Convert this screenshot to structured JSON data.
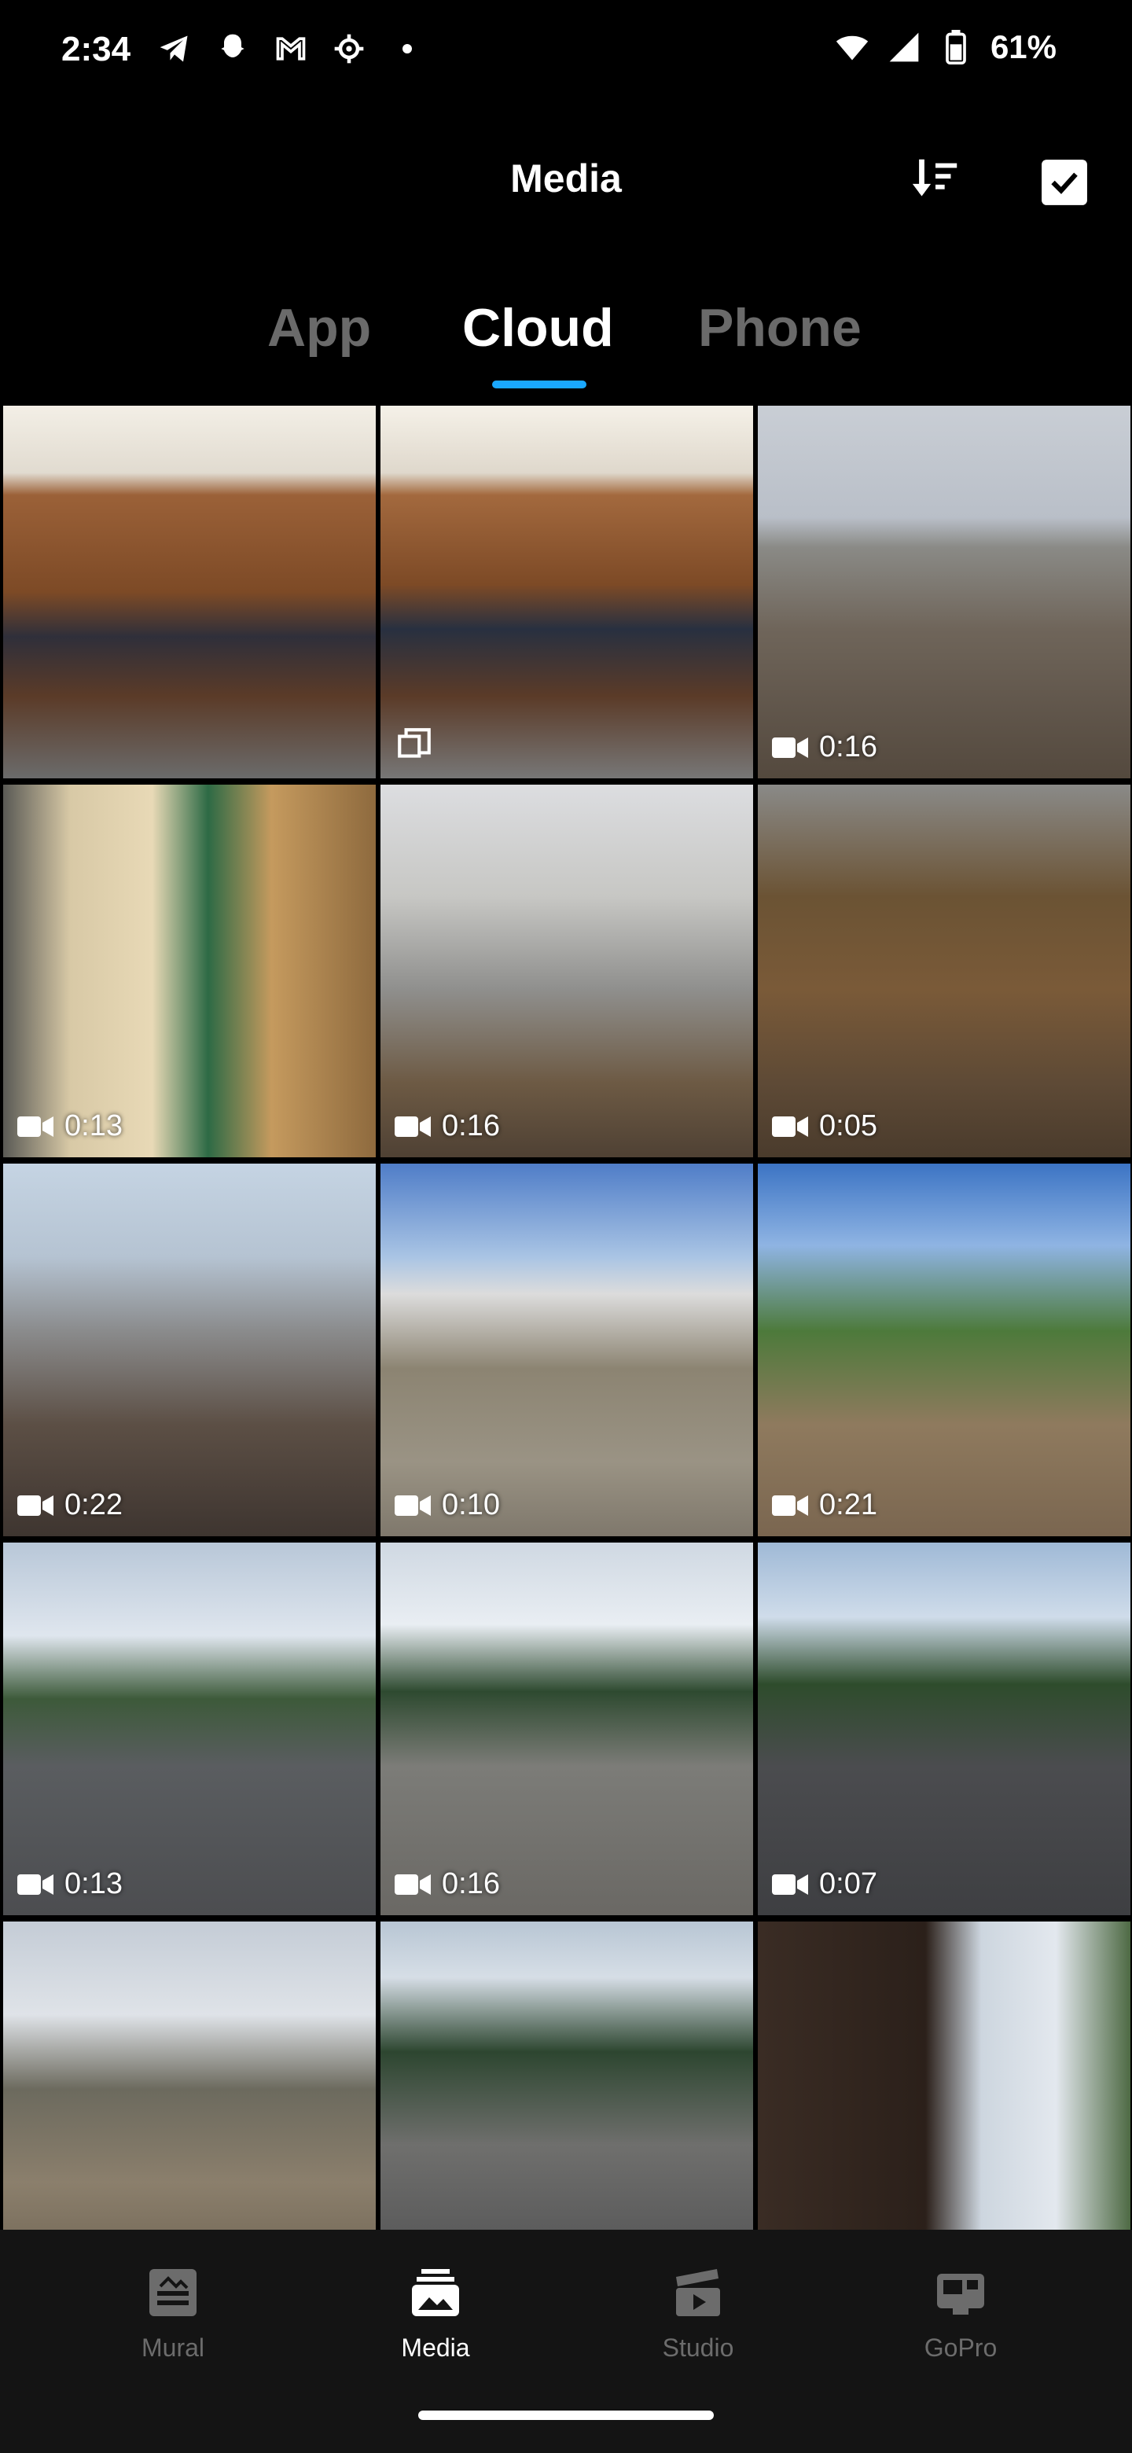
{
  "status_bar": {
    "time": "2:34",
    "battery_text": "61%"
  },
  "header": {
    "title": "Media"
  },
  "tabs": [
    {
      "label": "App",
      "active": false
    },
    {
      "label": "Cloud",
      "active": true
    },
    {
      "label": "Phone",
      "active": false
    }
  ],
  "grid": {
    "items": [
      {
        "type": "multi",
        "duration": ""
      },
      {
        "type": "multi",
        "duration": ""
      },
      {
        "type": "video",
        "duration": "0:16"
      },
      {
        "type": "video",
        "duration": "0:13"
      },
      {
        "type": "video",
        "duration": "0:16"
      },
      {
        "type": "video",
        "duration": "0:05"
      },
      {
        "type": "video",
        "duration": "0:22"
      },
      {
        "type": "video",
        "duration": "0:10"
      },
      {
        "type": "video",
        "duration": "0:21"
      },
      {
        "type": "video",
        "duration": "0:13"
      },
      {
        "type": "video",
        "duration": "0:16"
      },
      {
        "type": "video",
        "duration": "0:07"
      },
      {
        "type": "photo",
        "duration": ""
      },
      {
        "type": "photo",
        "duration": ""
      },
      {
        "type": "photo",
        "duration": ""
      }
    ]
  },
  "bottom_nav": {
    "mural": "Mural",
    "media": "Media",
    "studio": "Studio",
    "gopro": "GoPro"
  },
  "colors": {
    "accent": "#1aa8ff",
    "inactive_text": "#6c6c6c"
  }
}
